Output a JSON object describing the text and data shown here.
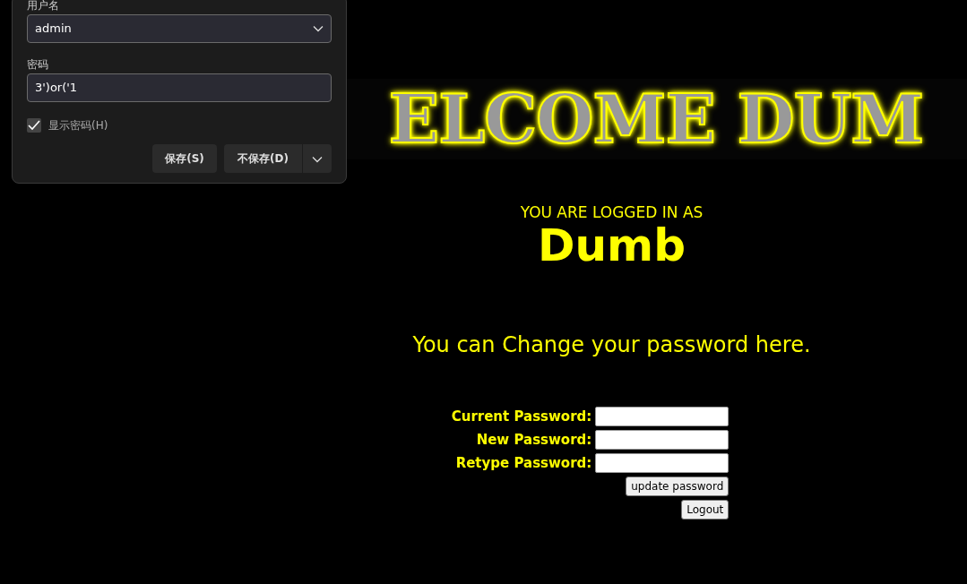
{
  "dialog": {
    "username_label": "用户名",
    "username": "admin",
    "password_label": "密码",
    "password": "3')or('1",
    "show_password": {
      "label": "显示密码(H)",
      "checked": true
    },
    "buttons": [
      {
        "label": "保存(S)"
      },
      {
        "label": "不保存(D)"
      }
    ]
  },
  "page": {
    "banner": "ELCOME DUM",
    "logged_in_label": "YOU ARE LOGGED IN AS",
    "user": "Dumb",
    "message": "You can Change your password here.",
    "fields": [
      {
        "label": "Current Password:"
      },
      {
        "label": "New Password:"
      },
      {
        "label": "Retype Password:"
      }
    ],
    "buttons": [
      "update password",
      "Logout"
    ]
  }
}
